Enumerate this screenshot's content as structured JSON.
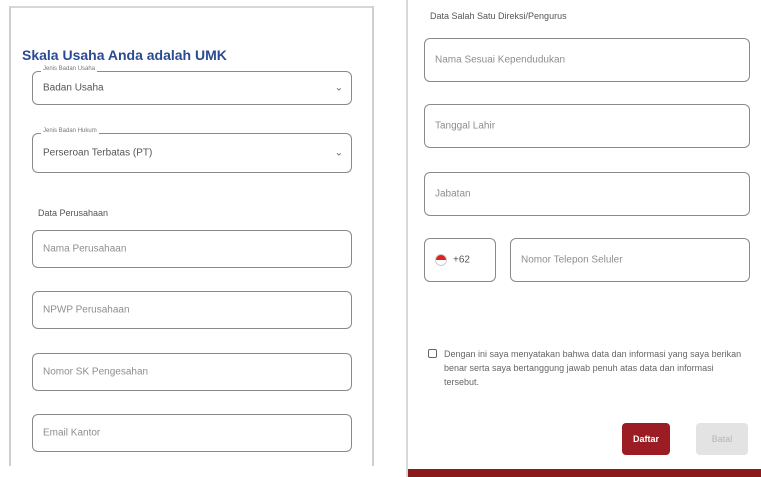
{
  "colors": {
    "accent": "#9b1c22",
    "heading": "#2a4b93",
    "border": "#8a8a8a"
  },
  "left": {
    "heading": "Skala Usaha Anda adalah UMK",
    "jenis_badan_usaha": {
      "legend": "Jenis Badan Usaha",
      "value": "Badan Usaha"
    },
    "jenis_badan_hukum": {
      "legend": "Jenis Badan Hukum",
      "value": "Perseroan Terbatas (PT)"
    },
    "section_label": "Data Perusahaan",
    "fields": [
      {
        "placeholder": "Nama Perusahaan"
      },
      {
        "placeholder": "NPWP Perusahaan"
      },
      {
        "placeholder": "Nomor SK Pengesahan"
      },
      {
        "placeholder": "Email Kantor"
      }
    ]
  },
  "right": {
    "section_label": "Data Salah Satu Direksi/Pengurus",
    "fields": [
      {
        "placeholder": "Nama Sesuai Kependudukan"
      },
      {
        "placeholder": "Tanggal Lahir"
      },
      {
        "placeholder": "Jabatan"
      }
    ],
    "phone": {
      "code": "+62",
      "flag_icon": "indonesia-flag-icon",
      "placeholder": "Nomor Telepon Seluler"
    },
    "consent_text": "Dengan ini saya menyatakan bahwa data dan informasi yang saya berikan benar serta saya bertanggung jawab penuh atas data dan informasi tersebut.",
    "buttons": {
      "primary": "Daftar",
      "secondary": "Batal"
    }
  }
}
